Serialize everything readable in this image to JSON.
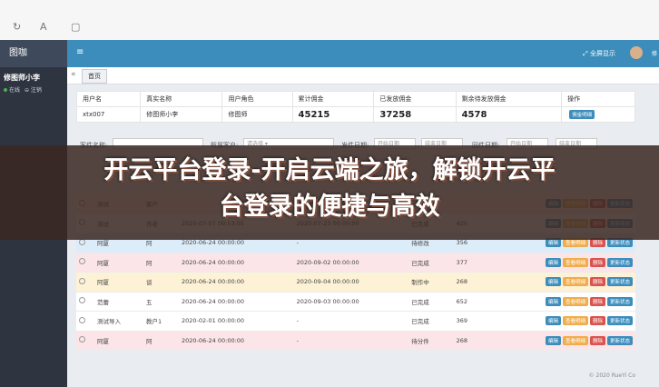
{
  "sidebar": {
    "logo": "图咖",
    "user_name": "修图师小李",
    "status_online": "在线",
    "logout": "注销"
  },
  "topbar": {
    "menu_icon": "hamburger-icon",
    "fullscreen": "全屏显示",
    "user_short": "修"
  },
  "tabs": {
    "arrow": "«",
    "home": "首页"
  },
  "summary": {
    "headers": [
      "用户名",
      "真实名称",
      "用户角色",
      "累计佣金",
      "已发放佣金",
      "剩余待发放佣金",
      "操作"
    ],
    "row": {
      "username": "xtx007",
      "realname": "修图师小李",
      "role": "修图师",
      "total": "45215",
      "paid": "37258",
      "remaining": "4578",
      "action": "佣金明细"
    }
  },
  "filter": {
    "field1": "客件名称:",
    "field2": "所属客户:",
    "select": "请选择",
    "date1": "发件日期:",
    "date1_from": "开始日期",
    "date1_to": "结束日期",
    "date2": "回件日期:",
    "date2_from": "开始日期",
    "date2_to": "结束日期"
  },
  "table": {
    "rows": [
      {
        "c1": "测试",
        "c2": "客户",
        "c3": "",
        "c4": "",
        "c5": "",
        "c6": ""
      },
      {
        "c1": "测试",
        "c2": "乔老",
        "c3": "2020-07-07 09:53:05",
        "c4": "2020-07-23 00:00:00",
        "c5": "已完成",
        "c6": "425"
      },
      {
        "c1": "阿厦",
        "c2": "阿",
        "c3": "2020-06-24 00:00:00",
        "c4": "-",
        "c5": "待修改",
        "c6": "356"
      },
      {
        "c1": "阿厦",
        "c2": "阿",
        "c3": "2020-06-24 00:00:00",
        "c4": "2020-09-02 00:00:00",
        "c5": "已完成",
        "c6": "377"
      },
      {
        "c1": "阿厦",
        "c2": "谈",
        "c3": "2020-06-24 00:00:00",
        "c4": "2020-09-04 00:00:00",
        "c5": "制作中",
        "c6": "268"
      },
      {
        "c1": "范蕾",
        "c2": "五",
        "c3": "2020-06-24 00:00:00",
        "c4": "2020-09-03 00:00:00",
        "c5": "已完成",
        "c6": "652"
      },
      {
        "c1": "测试导入",
        "c2": "教户1",
        "c3": "2020-02-01 00:00:00",
        "c4": "-",
        "c5": "已完成",
        "c6": "369"
      },
      {
        "c1": "阿厦",
        "c2": "阿",
        "c3": "2020-06-24 00:00:00",
        "c4": "-",
        "c5": "待分件",
        "c6": "268"
      }
    ],
    "btn_edit": "编辑",
    "btn_mark": "查看明细",
    "btn_del": "删除",
    "btn_stat": "更新状态"
  },
  "footer": "© 2020 RueYi Co",
  "banner": {
    "line1": "开云平台登录-开启云端之旅，解锁开云平",
    "line2": "台登录的便捷与高效"
  },
  "colors": {
    "topbar": "#3c8dbc",
    "sidebar": "#2e3440",
    "banner": "#3a2822"
  }
}
